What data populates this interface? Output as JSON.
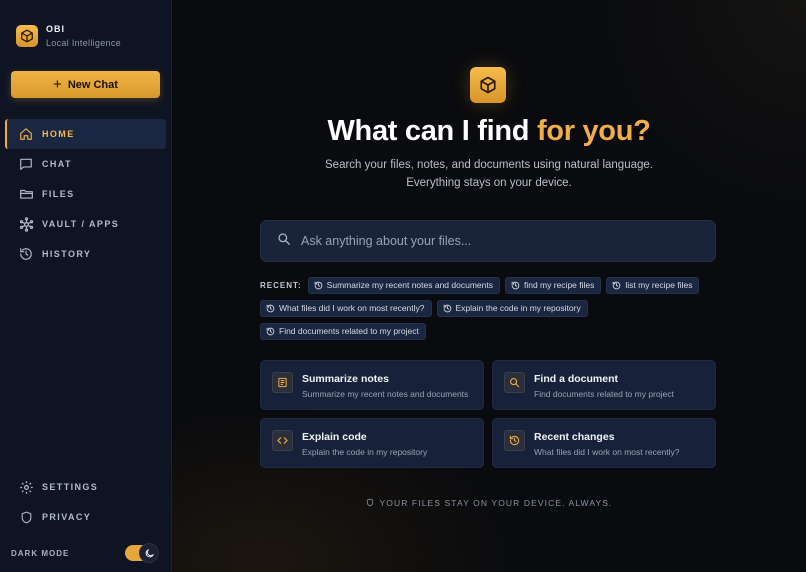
{
  "sidebar": {
    "brand": {
      "name": "OBI",
      "subtitle": "Local Intelligence",
      "icon": "cube-icon"
    },
    "new_chat_label": "New Chat",
    "nav": [
      {
        "label": "HOME",
        "icon": "home-icon",
        "active": true
      },
      {
        "label": "CHAT",
        "icon": "chat-icon",
        "active": false
      },
      {
        "label": "FILES",
        "icon": "folder-icon",
        "active": false
      },
      {
        "label": "VAULT / APPS",
        "icon": "apps-icon",
        "active": false
      },
      {
        "label": "HISTORY",
        "icon": "history-icon",
        "active": false
      }
    ],
    "bottom_nav": [
      {
        "label": "SETTINGS",
        "icon": "gear-icon"
      },
      {
        "label": "PRIVACY",
        "icon": "shield-icon"
      }
    ],
    "dark_mode": {
      "label": "DARK MODE",
      "enabled": true
    }
  },
  "main": {
    "headline_primary": "What can I find",
    "headline_accent": "for you?",
    "subline_1": "Search your files, notes, and documents using natural language.",
    "subline_2": "Everything stays on your device.",
    "search": {
      "placeholder": "Ask anything about your files..."
    },
    "recent_label": "RECENT:",
    "recent": [
      "Summarize my recent notes and documents",
      "find my recipe files",
      "list my recipe files",
      "What files did I work on most recently?",
      "Explain the code in my repository",
      "Find documents related to my project"
    ],
    "cards": [
      {
        "title": "Summarize notes",
        "description": "Summarize my recent notes and documents",
        "icon": "notes-icon"
      },
      {
        "title": "Find a document",
        "description": "Find documents related to my project",
        "icon": "search-icon"
      },
      {
        "title": "Explain code",
        "description": "Explain the code in my repository",
        "icon": "code-icon"
      },
      {
        "title": "Recent changes",
        "description": "What files did I work on most recently?",
        "icon": "history-icon"
      }
    ],
    "footer": "YOUR FILES STAY ON YOUR DEVICE. ALWAYS."
  },
  "colors": {
    "accent": "#f0ad44",
    "sidebar_bg": "#0e1422",
    "main_bg": "#0a0b0e",
    "card_bg": "#17223a"
  }
}
